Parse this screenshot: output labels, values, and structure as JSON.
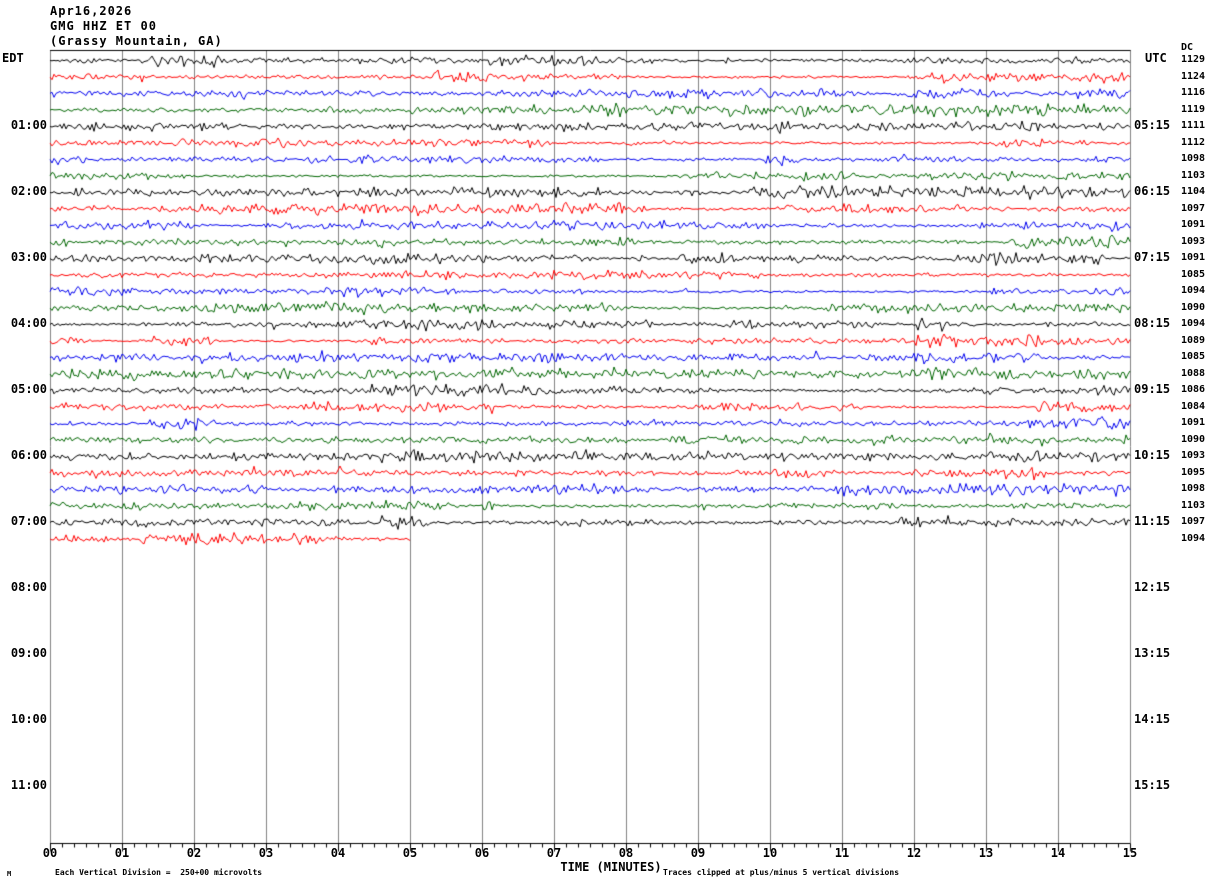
{
  "header": {
    "date": "Apr16,2026",
    "station": "GMG HHZ ET 00",
    "location": "(Grassy Mountain, GA)"
  },
  "left_axis": {
    "label": "EDT"
  },
  "right_axis": {
    "label": "UTC",
    "dc_label": "DC"
  },
  "x_axis": {
    "label": "TIME (MINUTES)"
  },
  "footer": {
    "division_note": "Each Vertical Division =  250+00 microvolts",
    "clip_note": "Traces clipped at plus/minus 5 vertical divisions",
    "watermark": "M"
  },
  "chart_data": {
    "type": "line",
    "subtype": "helicorder-seismogram",
    "title": "GMG HHZ ET 00 (Grassy Mountain, GA) Apr16,2026",
    "xlabel": "TIME (MINUTES)",
    "x_range_minutes": [
      0,
      15
    ],
    "x_ticks": [
      "00",
      "01",
      "02",
      "03",
      "04",
      "05",
      "06",
      "07",
      "08",
      "09",
      "10",
      "11",
      "12",
      "13",
      "14",
      "15"
    ],
    "minor_ticks_per_minute": 6,
    "grid": true,
    "grid_color": "#808080",
    "trace_colors": [
      "#000000",
      "#ff0000",
      "#0000ee",
      "#006600"
    ],
    "clip_divisions": 5,
    "division_microvolts": "250+00",
    "rows": [
      {
        "dc": 1129,
        "end_min": 15
      },
      {
        "dc": 1124,
        "end_min": 15
      },
      {
        "dc": 1116,
        "end_min": 15
      },
      {
        "dc": 1119,
        "end_min": 15
      },
      {
        "dc": 1111,
        "end_min": 15
      },
      {
        "dc": 1112,
        "end_min": 15
      },
      {
        "dc": 1098,
        "end_min": 15
      },
      {
        "dc": 1103,
        "end_min": 15
      },
      {
        "dc": 1104,
        "end_min": 15
      },
      {
        "dc": 1097,
        "end_min": 15
      },
      {
        "dc": 1091,
        "end_min": 15
      },
      {
        "dc": 1093,
        "end_min": 15
      },
      {
        "dc": 1091,
        "end_min": 15
      },
      {
        "dc": 1085,
        "end_min": 15
      },
      {
        "dc": 1094,
        "end_min": 15
      },
      {
        "dc": 1090,
        "end_min": 15
      },
      {
        "dc": 1094,
        "end_min": 15
      },
      {
        "dc": 1089,
        "end_min": 15
      },
      {
        "dc": 1085,
        "end_min": 15
      },
      {
        "dc": 1088,
        "end_min": 15
      },
      {
        "dc": 1086,
        "end_min": 15
      },
      {
        "dc": 1084,
        "end_min": 15
      },
      {
        "dc": 1091,
        "end_min": 15
      },
      {
        "dc": 1090,
        "end_min": 15
      },
      {
        "dc": 1093,
        "end_min": 15
      },
      {
        "dc": 1095,
        "end_min": 15
      },
      {
        "dc": 1098,
        "end_min": 15
      },
      {
        "dc": 1103,
        "end_min": 15
      },
      {
        "dc": 1097,
        "end_min": 15
      },
      {
        "dc": 1094,
        "end_min": 5
      }
    ],
    "hour_marks": [
      {
        "row": 4,
        "edt": "01:00",
        "utc": "05:15"
      },
      {
        "row": 8,
        "edt": "02:00",
        "utc": "06:15"
      },
      {
        "row": 12,
        "edt": "03:00",
        "utc": "07:15"
      },
      {
        "row": 16,
        "edt": "04:00",
        "utc": "08:15"
      },
      {
        "row": 20,
        "edt": "05:00",
        "utc": "09:15"
      },
      {
        "row": 24,
        "edt": "06:00",
        "utc": "10:15"
      },
      {
        "row": 28,
        "edt": "07:00",
        "utc": "11:15"
      },
      {
        "row": 32,
        "edt": "08:00",
        "utc": "12:15"
      },
      {
        "row": 36,
        "edt": "09:00",
        "utc": "13:15"
      },
      {
        "row": 40,
        "edt": "10:00",
        "utc": "14:15"
      },
      {
        "row": 44,
        "edt": "11:00",
        "utc": "15:15"
      }
    ]
  }
}
